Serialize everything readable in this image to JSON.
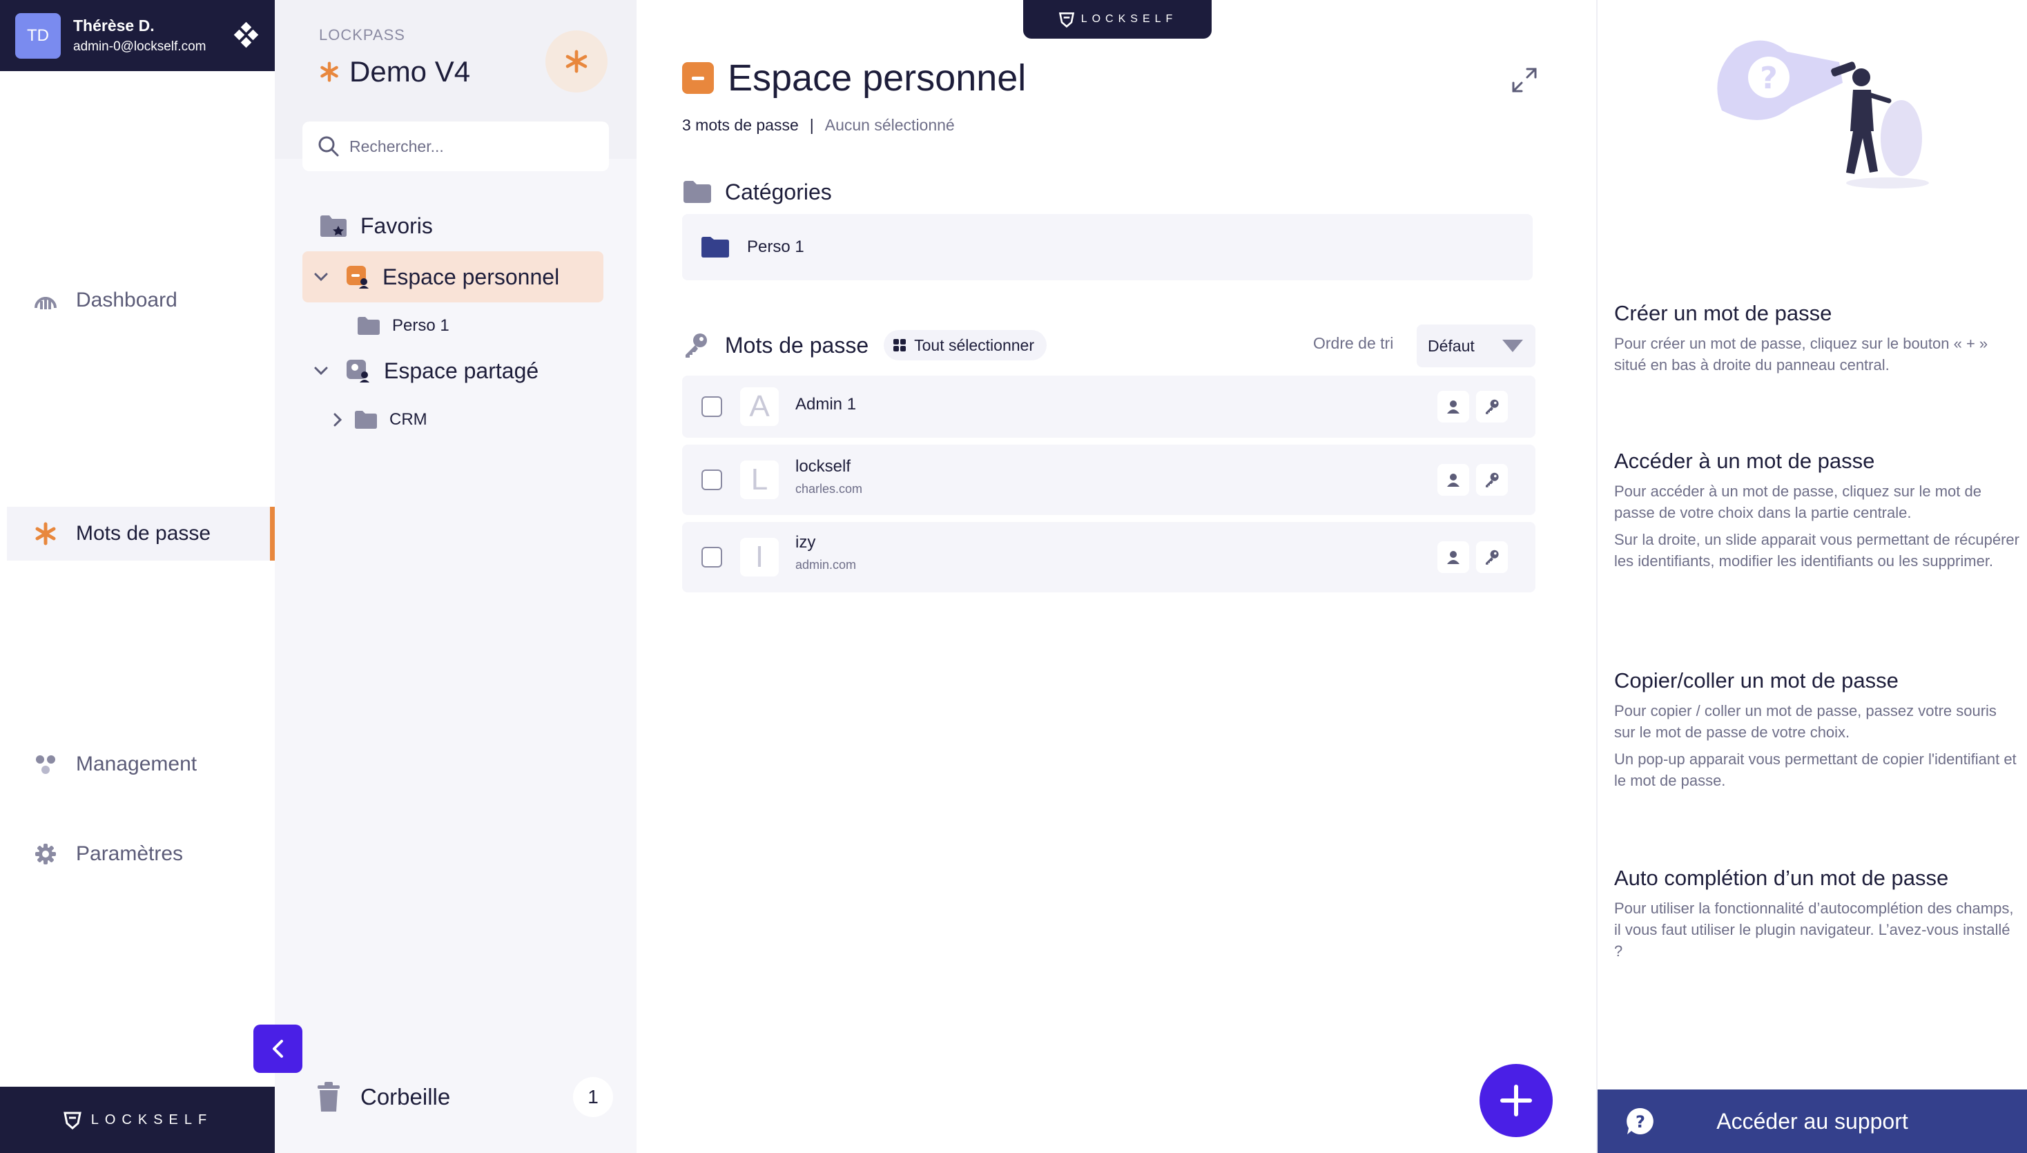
{
  "user": {
    "initials": "TD",
    "name": "Thérèse D.",
    "email": "admin-0@lockself.com"
  },
  "nav": {
    "items": [
      {
        "label": "Dashboard",
        "icon": "dashboard-icon",
        "active": false
      },
      {
        "label": "Mots de passe",
        "icon": "asterisk-icon",
        "active": true
      },
      {
        "label": "Management",
        "icon": "management-icon",
        "active": false
      },
      {
        "label": "Paramètres",
        "icon": "gear-icon",
        "active": false
      }
    ]
  },
  "brand": {
    "name": "LOCKSELF"
  },
  "vault": {
    "label": "LOCKPASS",
    "name": "Demo V4"
  },
  "search": {
    "placeholder": "Rechercher..."
  },
  "tree": {
    "favorites": "Favoris",
    "personal": "Espace personnel",
    "personal_children": [
      "Perso 1"
    ],
    "shared": "Espace partagé",
    "shared_children": [
      "CRM"
    ]
  },
  "trash": {
    "label": "Corbeille",
    "count": "1"
  },
  "main": {
    "title": "Espace personnel",
    "password_count": "3 mots de passe",
    "separator": "|",
    "selection": "Aucun sélectionné",
    "categories_title": "Catégories",
    "categories": [
      "Perso 1"
    ],
    "passwords_title": "Mots de passe",
    "select_all": "Tout sélectionner",
    "sort_label": "Ordre de tri",
    "sort_value": "Défaut",
    "passwords": [
      {
        "letter": "A",
        "name": "Admin 1",
        "url": ""
      },
      {
        "letter": "L",
        "name": "lockself",
        "url": "charles.com"
      },
      {
        "letter": "I",
        "name": "izy",
        "url": "admin.com"
      }
    ]
  },
  "help": {
    "blocks": [
      {
        "title": "Créer un mot de passe",
        "paragraphs": [
          "Pour créer un mot de passe, cliquez sur le bouton « + » situé en bas à droite du panneau central."
        ]
      },
      {
        "title": "Accéder à un mot de passe",
        "paragraphs": [
          "Pour accéder à un mot de passe, cliquez sur le mot de passe de votre choix dans la partie centrale.",
          "Sur la droite, un slide apparait vous permettant de récupérer les identifiants, modifier les identifiants ou les supprimer."
        ]
      },
      {
        "title": "Copier/coller un mot de passe",
        "paragraphs": [
          "Pour copier / coller un mot de passe, passez votre souris sur le mot de passe de votre choix.",
          "Un pop-up apparait vous permettant de copier l'identifiant et le mot de passe."
        ]
      },
      {
        "title": "Auto complétion d’un mot de passe",
        "paragraphs": [
          "Pour utiliser la fonctionnalité d’autocomplétion des champs, il vous faut utiliser le plugin navigateur. L’avez-vous installé ?"
        ]
      }
    ],
    "support_label": "Accéder au support"
  },
  "colors": {
    "accent": "#4a1fe6",
    "brand_dark": "#1c1c3c",
    "orange": "#e8873d",
    "support": "#34408c"
  }
}
